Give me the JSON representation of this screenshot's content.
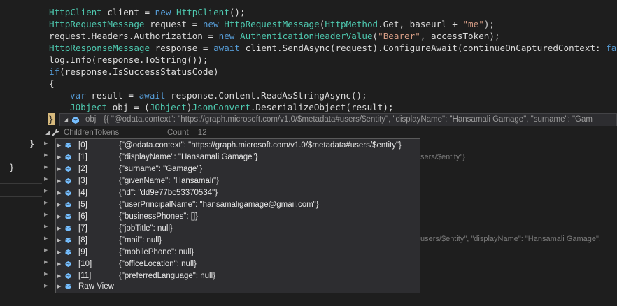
{
  "code": {
    "line1": {
      "t1": "HttpClient",
      "t2": " client = ",
      "t3": "new",
      "t4": " ",
      "t5": "HttpClient",
      "t6": "();"
    },
    "line2": {
      "t1": "HttpRequestMessage",
      "t2": " request = ",
      "t3": "new",
      "t4": " ",
      "t5": "HttpRequestMessage",
      "t6": "(",
      "t7": "HttpMethod",
      "t8": ".Get, baseurl + ",
      "t9": "\"me\"",
      "t10": ");"
    },
    "line3": {
      "t1": "request.Headers.Authorization = ",
      "t2": "new",
      "t3": " ",
      "t4": "AuthenticationHeaderValue",
      "t5": "(",
      "t6": "\"Bearer\"",
      "t7": ", accessToken);"
    },
    "line4": {
      "t1": "HttpResponseMessage",
      "t2": " response = ",
      "t3": "await",
      "t4": " client.SendAsync(request).ConfigureAwait(continueOnCapturedContext: ",
      "t5": "false",
      "t6": ");"
    },
    "line5": {
      "t1": "log.Info(response.ToString());"
    },
    "line6": {
      "t1": "if",
      "t2": "(response.IsSuccessStatusCode)"
    },
    "line7": {
      "t1": "{"
    },
    "line8": {
      "t1": "var",
      "t2": " result = ",
      "t3": "await",
      "t4": " response.Content.ReadAsStringAsync();"
    },
    "line9": {
      "t1": "JObject",
      "t2": " obj = (",
      "t3": "JObject",
      "t4": ")",
      "t5": "JsonConvert",
      "t6": ".DeserializeObject(result);"
    },
    "line10": {
      "t1": "}"
    },
    "line12": {
      "t1": "}"
    },
    "line13": {
      "t1": "}"
    }
  },
  "datatip": {
    "name": "obj",
    "value": "{{  \"@odata.context\": \"https://graph.microsoft.com/v1.0/$metadata#users/$entity\",  \"displayName\": \"Hansamali Gamage\",  \"surname\": \"Gam",
    "children_label": "ChildrenTokens",
    "children_count": "Count = 12"
  },
  "background_fragments": {
    "frag1": "sers/$entity\"}",
    "frag2": "users/$entity\",  \"displayName\": \"Hansamali Gamage\","
  },
  "items": [
    {
      "index": "[0]",
      "value": "{\"@odata.context\": \"https://graph.microsoft.com/v1.0/$metadata#users/$entity\"}"
    },
    {
      "index": "[1]",
      "value": "{\"displayName\": \"Hansamali Gamage\"}"
    },
    {
      "index": "[2]",
      "value": "{\"surname\": \"Gamage\"}"
    },
    {
      "index": "[3]",
      "value": "{\"givenName\": \"Hansamali\"}"
    },
    {
      "index": "[4]",
      "value": "{\"id\": \"dd9e77bc53370534\"}"
    },
    {
      "index": "[5]",
      "value": "{\"userPrincipalName\": \"hansamaligamage@gmail.com\"}"
    },
    {
      "index": "[6]",
      "value": "{\"businessPhones\": []}"
    },
    {
      "index": "[7]",
      "value": "{\"jobTitle\": null}"
    },
    {
      "index": "[8]",
      "value": "{\"mail\": null}"
    },
    {
      "index": "[9]",
      "value": "{\"mobilePhone\": null}"
    },
    {
      "index": "[10]",
      "value": "{\"officeLocation\": null}"
    },
    {
      "index": "[11]",
      "value": "{\"preferredLanguage\": null}"
    }
  ],
  "raw_view": "Raw View",
  "colors": {
    "background": "#1e1e1e",
    "keyword": "#569cd6",
    "type": "#4ec9b0",
    "string": "#d69d85",
    "popup": "#2d2d30",
    "cube_icon": "#75beff"
  }
}
